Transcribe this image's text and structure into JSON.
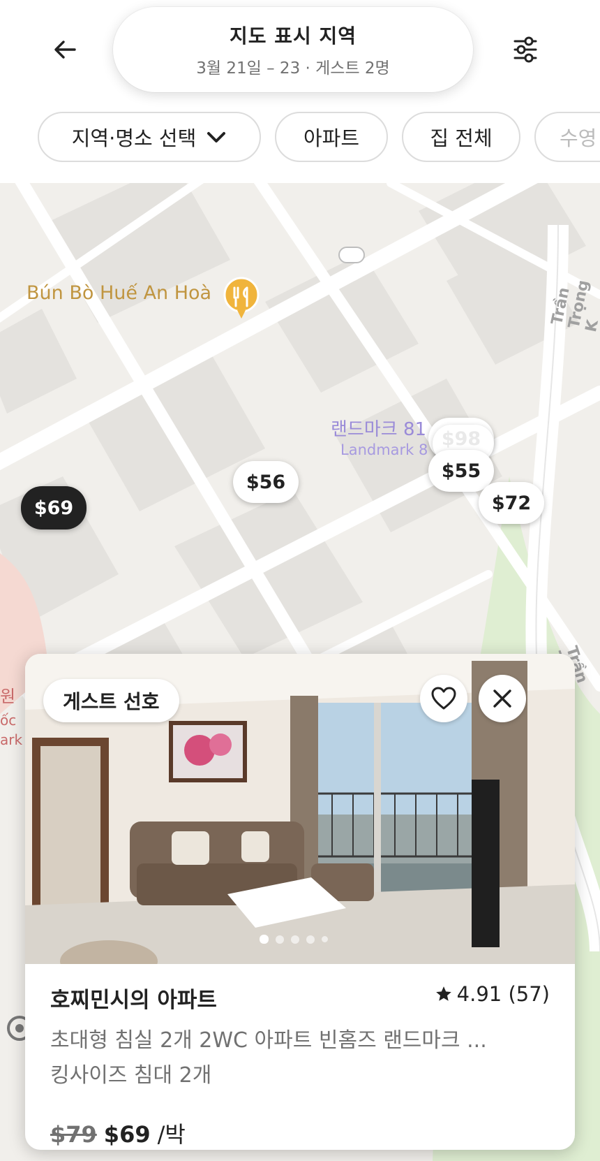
{
  "header": {
    "title": "지도 표시 지역",
    "subtitle": "3월 21일 – 23 · 게스트 2명",
    "back_icon": "arrow-left-icon",
    "filter_icon": "sliders-icon"
  },
  "chips": [
    {
      "label": "지역·명소 선택",
      "has_dropdown": true
    },
    {
      "label": "아파트"
    },
    {
      "label": "집 전체"
    },
    {
      "label": "수영"
    }
  ],
  "map": {
    "poi_restaurant": "Bún Bò Huế An Hoà",
    "landmark_ko": "랜드마크 81",
    "landmark_en": "Landmark 8",
    "road_label_1": "Trần Trọng K",
    "road_label_2": "Trần Trọng Kh",
    "edge_label_1": "원",
    "edge_label_2": "ốc",
    "edge_label_3": "ark",
    "price_pins": [
      {
        "label": "$69",
        "selected": true
      },
      {
        "label": "$56"
      },
      {
        "label": "$98"
      },
      {
        "label": "$55"
      },
      {
        "label": "$72"
      }
    ]
  },
  "listing": {
    "badge": "게스트 선호",
    "title": "호찌민시의 아파트",
    "rating": "4.91 (57)",
    "description": "초대형 침실 2개 2WC 아파트 빈홈즈 랜드마크 ...",
    "beds": "킹사이즈 침대 2개",
    "original_price": "$79",
    "price": "$69",
    "per_night": "/박",
    "photo_count": 5,
    "active_photo": 1
  },
  "colors": {
    "map_bg": "#f1efeb",
    "park": "#dfeed2",
    "accent_text": "#222222",
    "muted_text": "#717171"
  }
}
